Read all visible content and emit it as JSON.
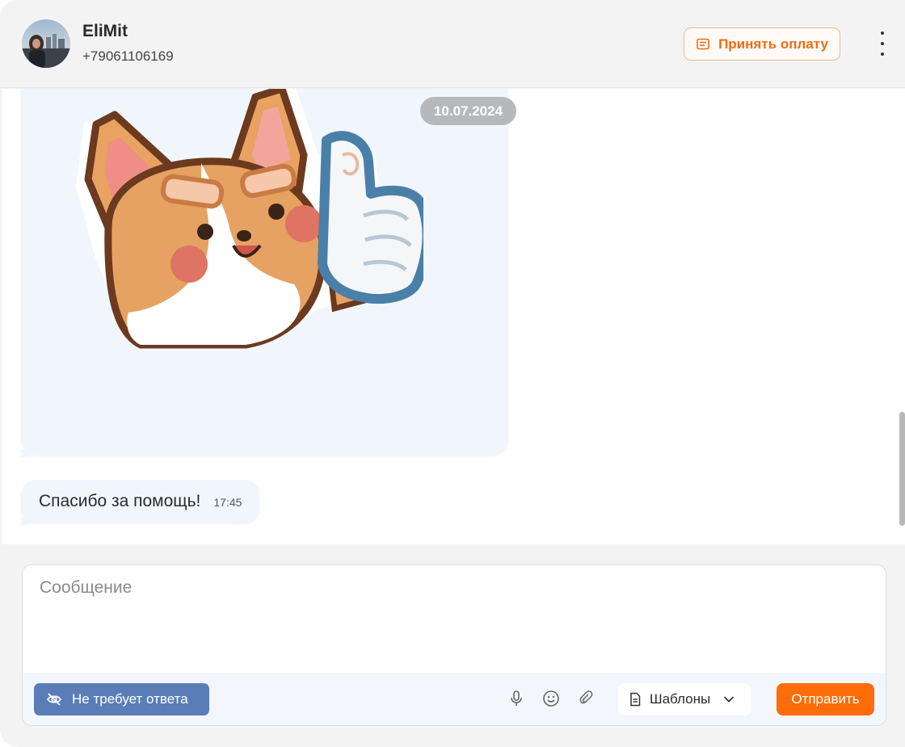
{
  "header": {
    "contact_name": "EliMit",
    "contact_phone": "+79061106169",
    "accept_payment_label": "Принять оплату",
    "more_icon": "more-vertical-icon"
  },
  "messages": {
    "sticker": {
      "date": "10.07.2024",
      "description_icon": "corgi-thumbs-up-sticker"
    },
    "text_message": {
      "text": "Спасибо за помощь!",
      "time": "17:45"
    }
  },
  "composer": {
    "placeholder": "Сообщение",
    "no_reply_label": "Не требует ответа",
    "templates_label": "Шаблоны",
    "send_label": "Отправить",
    "icons": [
      "eye-off-icon",
      "microphone-icon",
      "emoji-icon",
      "paperclip-icon",
      "document-icon",
      "chevron-down-icon"
    ]
  },
  "colors": {
    "accent": "#ff6c0a",
    "accent_border": "#f3b78a",
    "no_reply_bg": "#5a7db8",
    "bubble_bg": "#f1f6fd",
    "date_pill_bg": "#b6b8bc"
  }
}
